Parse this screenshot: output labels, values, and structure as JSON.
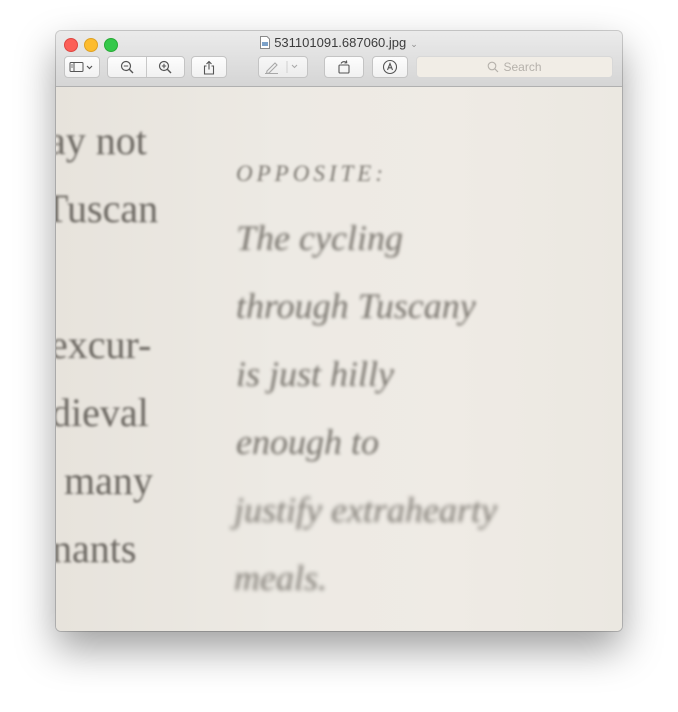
{
  "window": {
    "title": "531101091.687060.jpg",
    "title_icon": "image-document-icon"
  },
  "toolbar": {
    "search_placeholder": "Search",
    "buttons": [
      "sidebar-toggle",
      "zoom-out",
      "zoom-in",
      "share",
      "markup-pen",
      "rotate",
      "annotate"
    ]
  },
  "image_text": {
    "left_column": [
      "ay not",
      "Tuscan",
      "excur-",
      "dieval",
      "many",
      "nants"
    ],
    "caption_heading": "OPPOSITE:",
    "caption_lines": [
      "The cycling",
      "through Tuscany",
      "is just hilly",
      "enough to",
      "justify extrahearty",
      "meals."
    ]
  },
  "colors": {
    "close": "#fc5f57",
    "minimize": "#fdbc2e",
    "maximize": "#34c84a",
    "paper": "#edeae4",
    "ink": "#6a6660"
  }
}
